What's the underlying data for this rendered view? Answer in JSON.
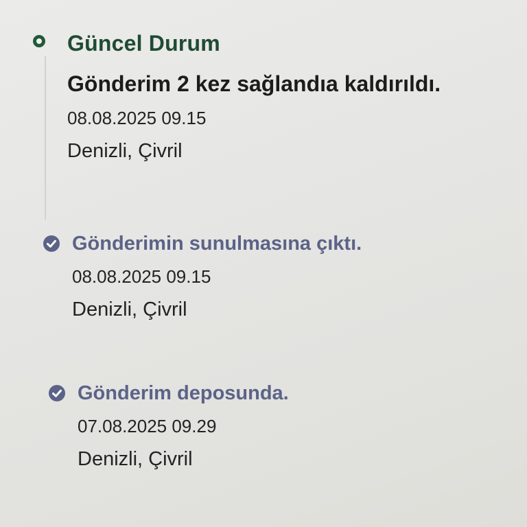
{
  "events": [
    {
      "title": "Güncel Durum",
      "description": "Gönderim 2 kez sağlandıa kaldırıldı.",
      "datetime": "08.08.2025 09.15",
      "location": "Denizli, Çivril",
      "status": "current",
      "icon": "current-status-ring-icon"
    },
    {
      "title": "Gönderimin sunulmasına çıktı.",
      "datetime": "08.08.2025 09.15",
      "location": "Denizli, Çivril",
      "status": "completed",
      "icon": "check-circle-icon"
    },
    {
      "title": "Gönderim deposunda.",
      "datetime": "07.08.2025 09.29",
      "location": "Denizli, Çivril",
      "status": "completed",
      "icon": "check-circle-icon"
    }
  ],
  "colors": {
    "current": "#1f5a3a",
    "completed": "#5c6387",
    "text": "#232323",
    "background": "#e6e6e4"
  }
}
